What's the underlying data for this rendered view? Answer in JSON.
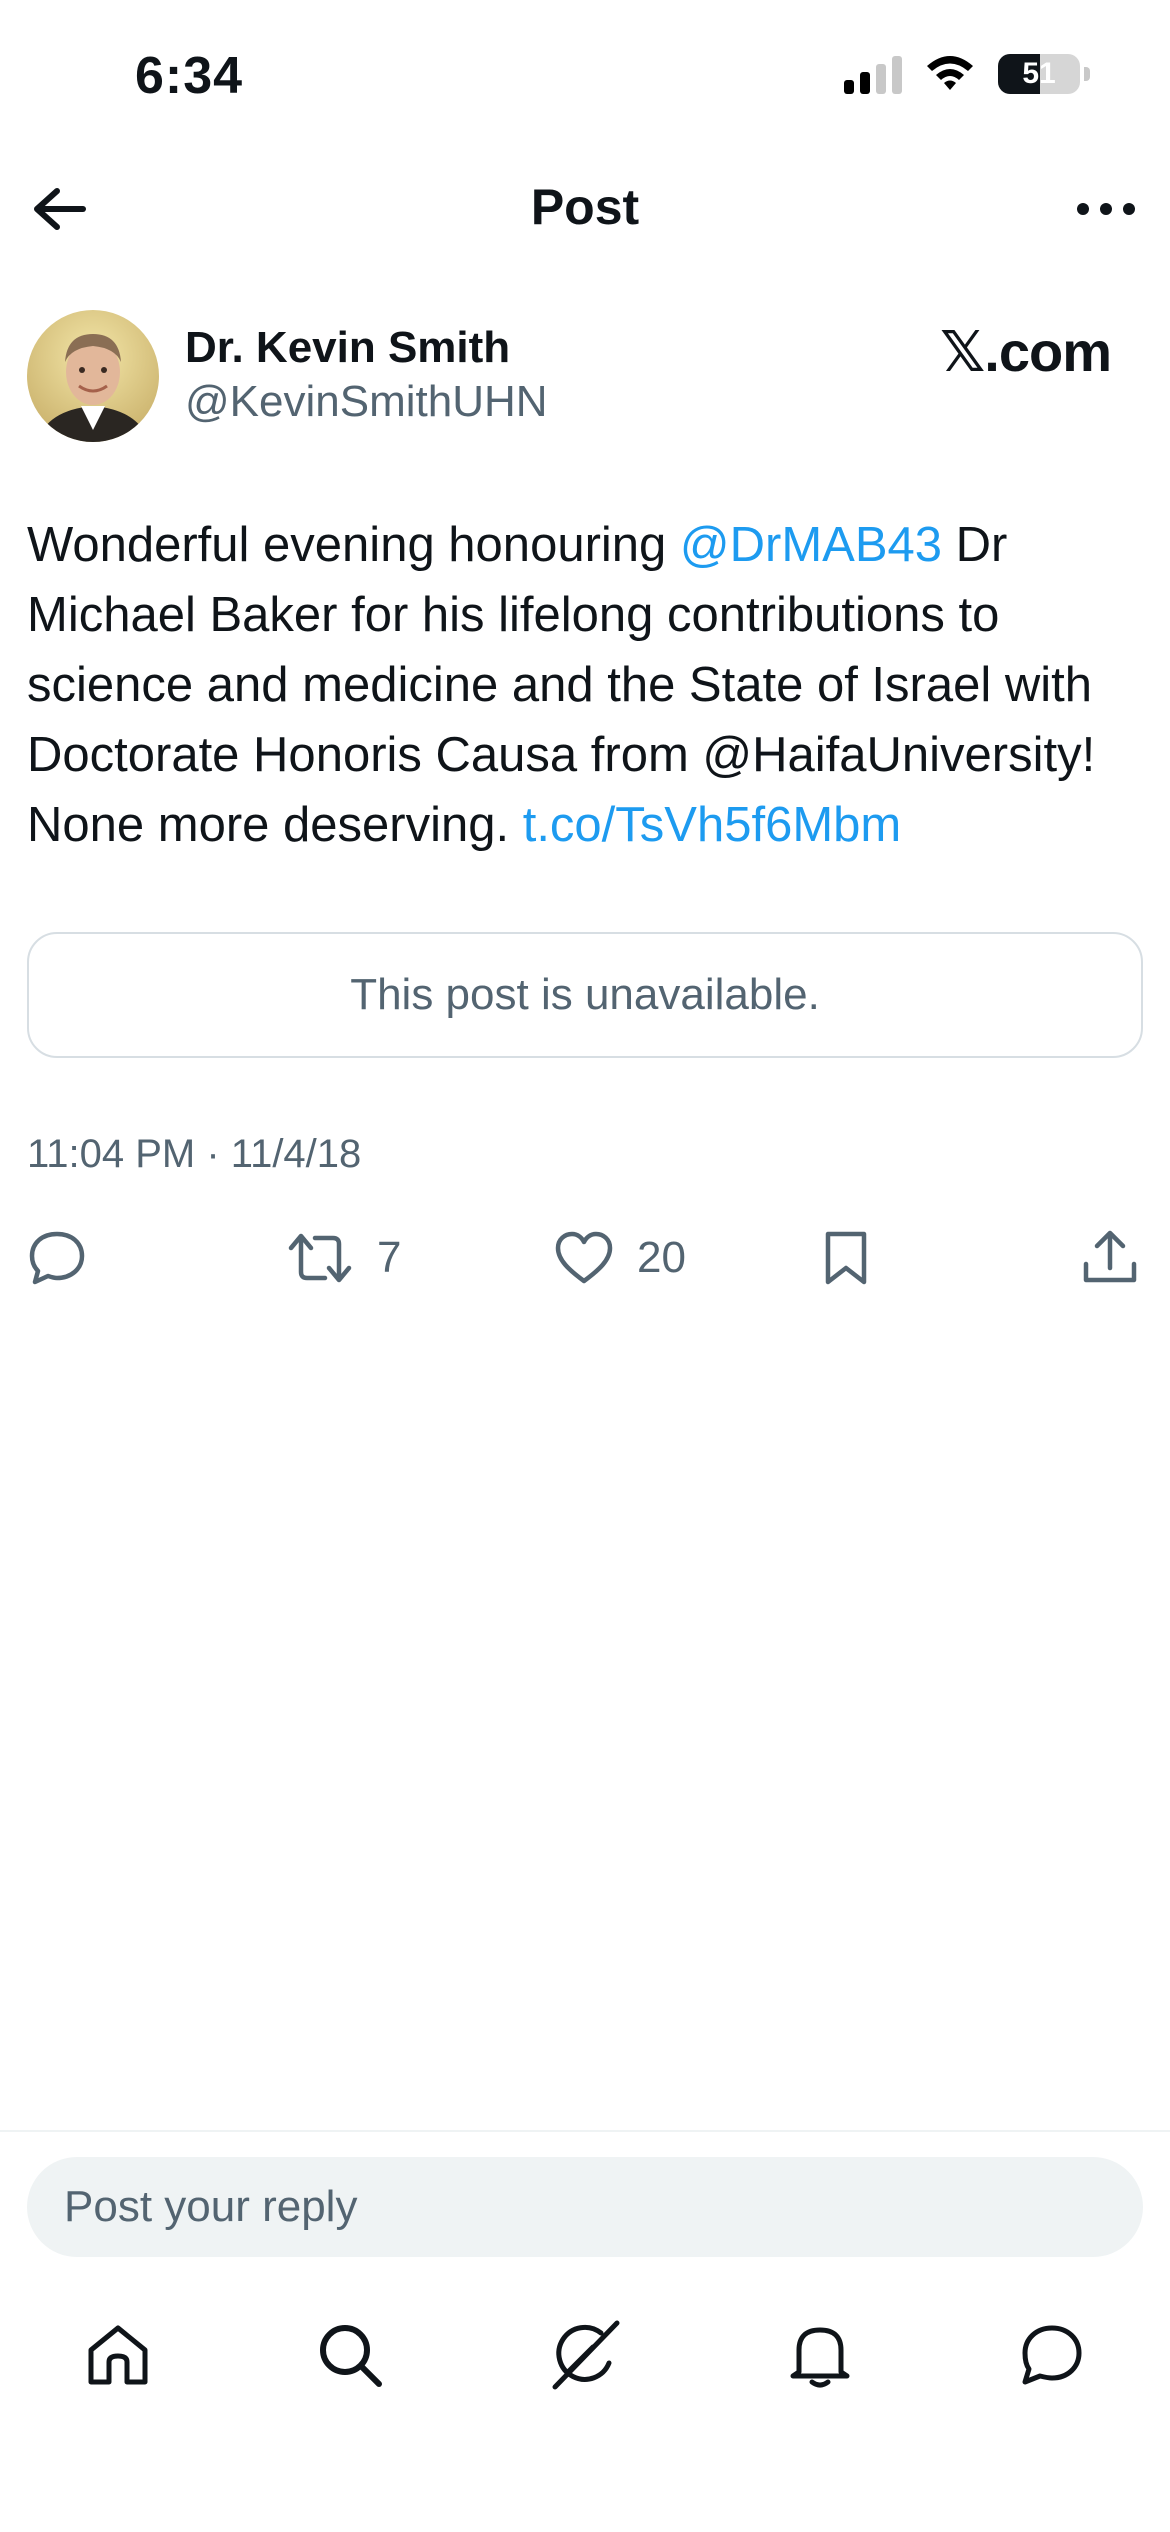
{
  "status_bar": {
    "time": "6:34",
    "battery": "51",
    "battery_level": 0.51
  },
  "header": {
    "title": "Post"
  },
  "post": {
    "author": {
      "name": "Dr. Kevin Smith",
      "handle": "@KevinSmithUHN"
    },
    "brand": "𝕏.com",
    "text": {
      "part1": "Wonderful evening honouring ",
      "mention": "@DrMAB43",
      "part2": " Dr Michael Baker for his lifelong contributions to science and medicine and the State of Israel with Doctorate Honoris Causa from @HaifaUniversity! None more deserving. ",
      "link": "t.co/TsVh5f6Mbm"
    },
    "quoted_unavailable": "This post is unavailable.",
    "timestamp": "11:04 PM · 11/4/18",
    "actions": {
      "reply_count": "",
      "retweet_count": "7",
      "like_count": "20"
    }
  },
  "reply": {
    "placeholder": "Post your reply"
  },
  "tab_bar": {
    "items": [
      "home-icon",
      "search-icon",
      "grok-icon",
      "notifications-icon",
      "messages-icon"
    ]
  }
}
